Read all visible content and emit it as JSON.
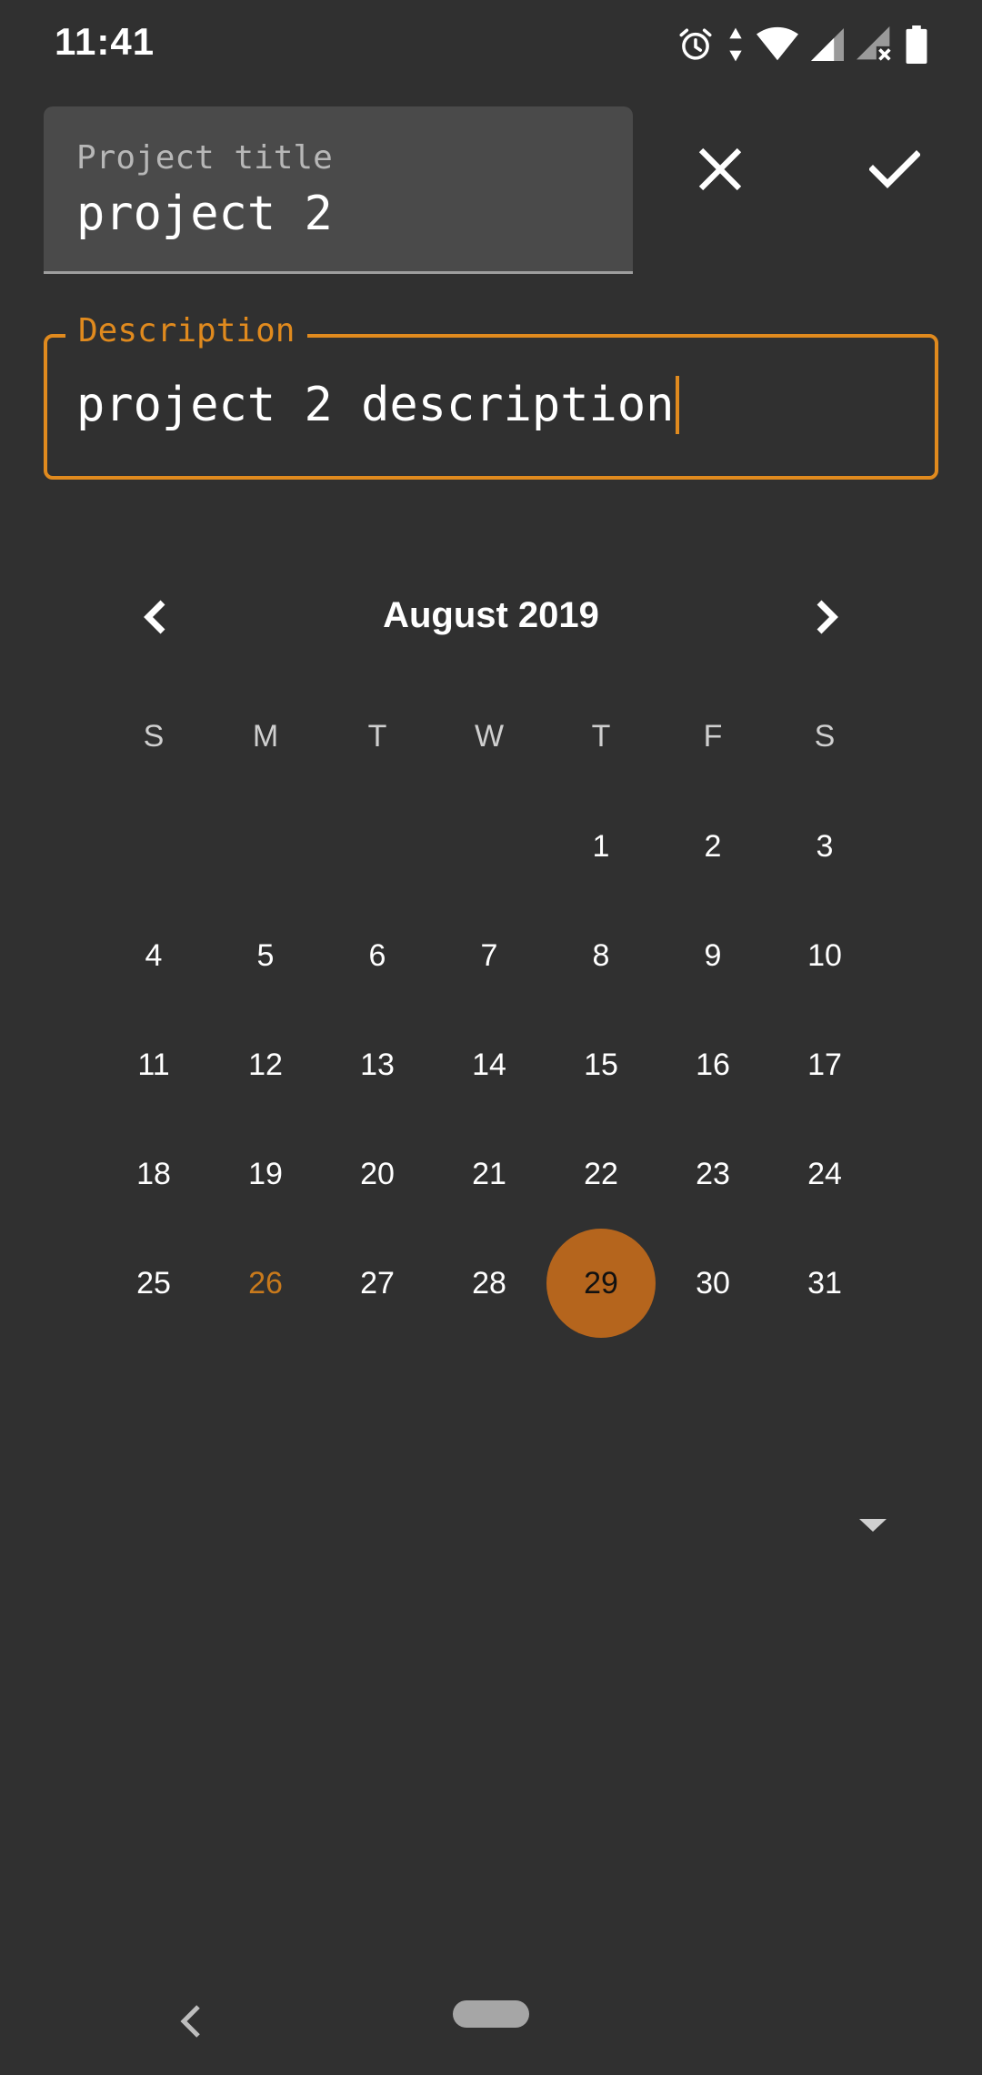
{
  "status_bar": {
    "time": "11:41",
    "icons": [
      "alarm-icon",
      "data-arrows-icon",
      "wifi-icon",
      "signal-icon",
      "signal-no-data-icon",
      "battery-icon"
    ]
  },
  "form": {
    "title_label": "Project title",
    "title_value": "project 2",
    "description_label": "Description",
    "description_value": "project 2 description",
    "accent_color": "#e08a1e"
  },
  "actions": {
    "close_icon": "close-icon",
    "confirm_icon": "check-icon"
  },
  "calendar": {
    "month_label": "August 2019",
    "weekdays": [
      "S",
      "M",
      "T",
      "W",
      "T",
      "F",
      "S"
    ],
    "first_weekday_index": 4,
    "days_in_month": 31,
    "today": 26,
    "selected": 29,
    "selected_color": "#b5651d"
  },
  "nav": {
    "back_icon": "back-icon",
    "home_icon": "home-pill-icon"
  }
}
